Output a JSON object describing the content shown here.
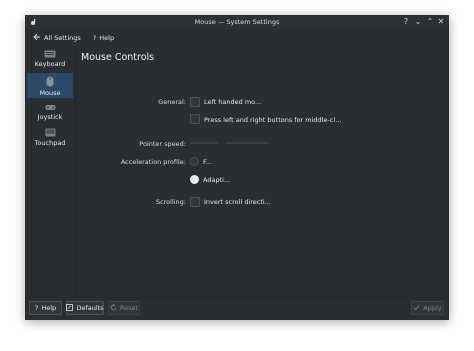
{
  "window": {
    "title": "Mouse — System Settings",
    "controls": {
      "help": "?",
      "minimize": "⌄",
      "maximize": "⌃",
      "close": "✕"
    }
  },
  "toolbar": {
    "back_label": "All Settings",
    "help_label": "Help",
    "help_glyph": "?"
  },
  "sidebar": {
    "items": [
      {
        "label": "Keyboard",
        "icon": "keyboard-icon",
        "active": false
      },
      {
        "label": "Mouse",
        "icon": "mouse-icon",
        "active": true
      },
      {
        "label": "Joystick",
        "icon": "joystick-icon",
        "active": false
      },
      {
        "label": "Touchpad",
        "icon": "touchpad-icon",
        "active": false
      }
    ]
  },
  "main": {
    "title": "Mouse Controls",
    "general_label": "General:",
    "left_handed_label": "Left handed mo...",
    "middle_click_label": "Press left and right buttons for middle-cl...",
    "pointer_speed_label": "Pointer speed:",
    "accel_label": "Acceleration profile:",
    "accel_flat_label": "F...",
    "accel_adaptive_label": "Adapti...",
    "accel_selected": "Adaptive",
    "scrolling_label": "Scrolling:",
    "invert_scroll_label": "Invert scroll directi..."
  },
  "footer": {
    "help_label": "Help",
    "defaults_label": "Defaults",
    "reset_label": "Reset",
    "apply_label": "Apply"
  },
  "colors": {
    "window_bg": "#2a2e33",
    "accent_selection": "#2b4a6a",
    "text": "#e6e8ea"
  }
}
